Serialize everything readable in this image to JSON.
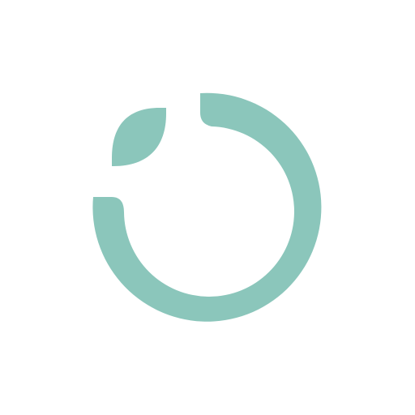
{
  "logo": {
    "icon": "ring-with-leaf-icon",
    "color": "#8BC6BB",
    "background": "#FFFFFF"
  }
}
